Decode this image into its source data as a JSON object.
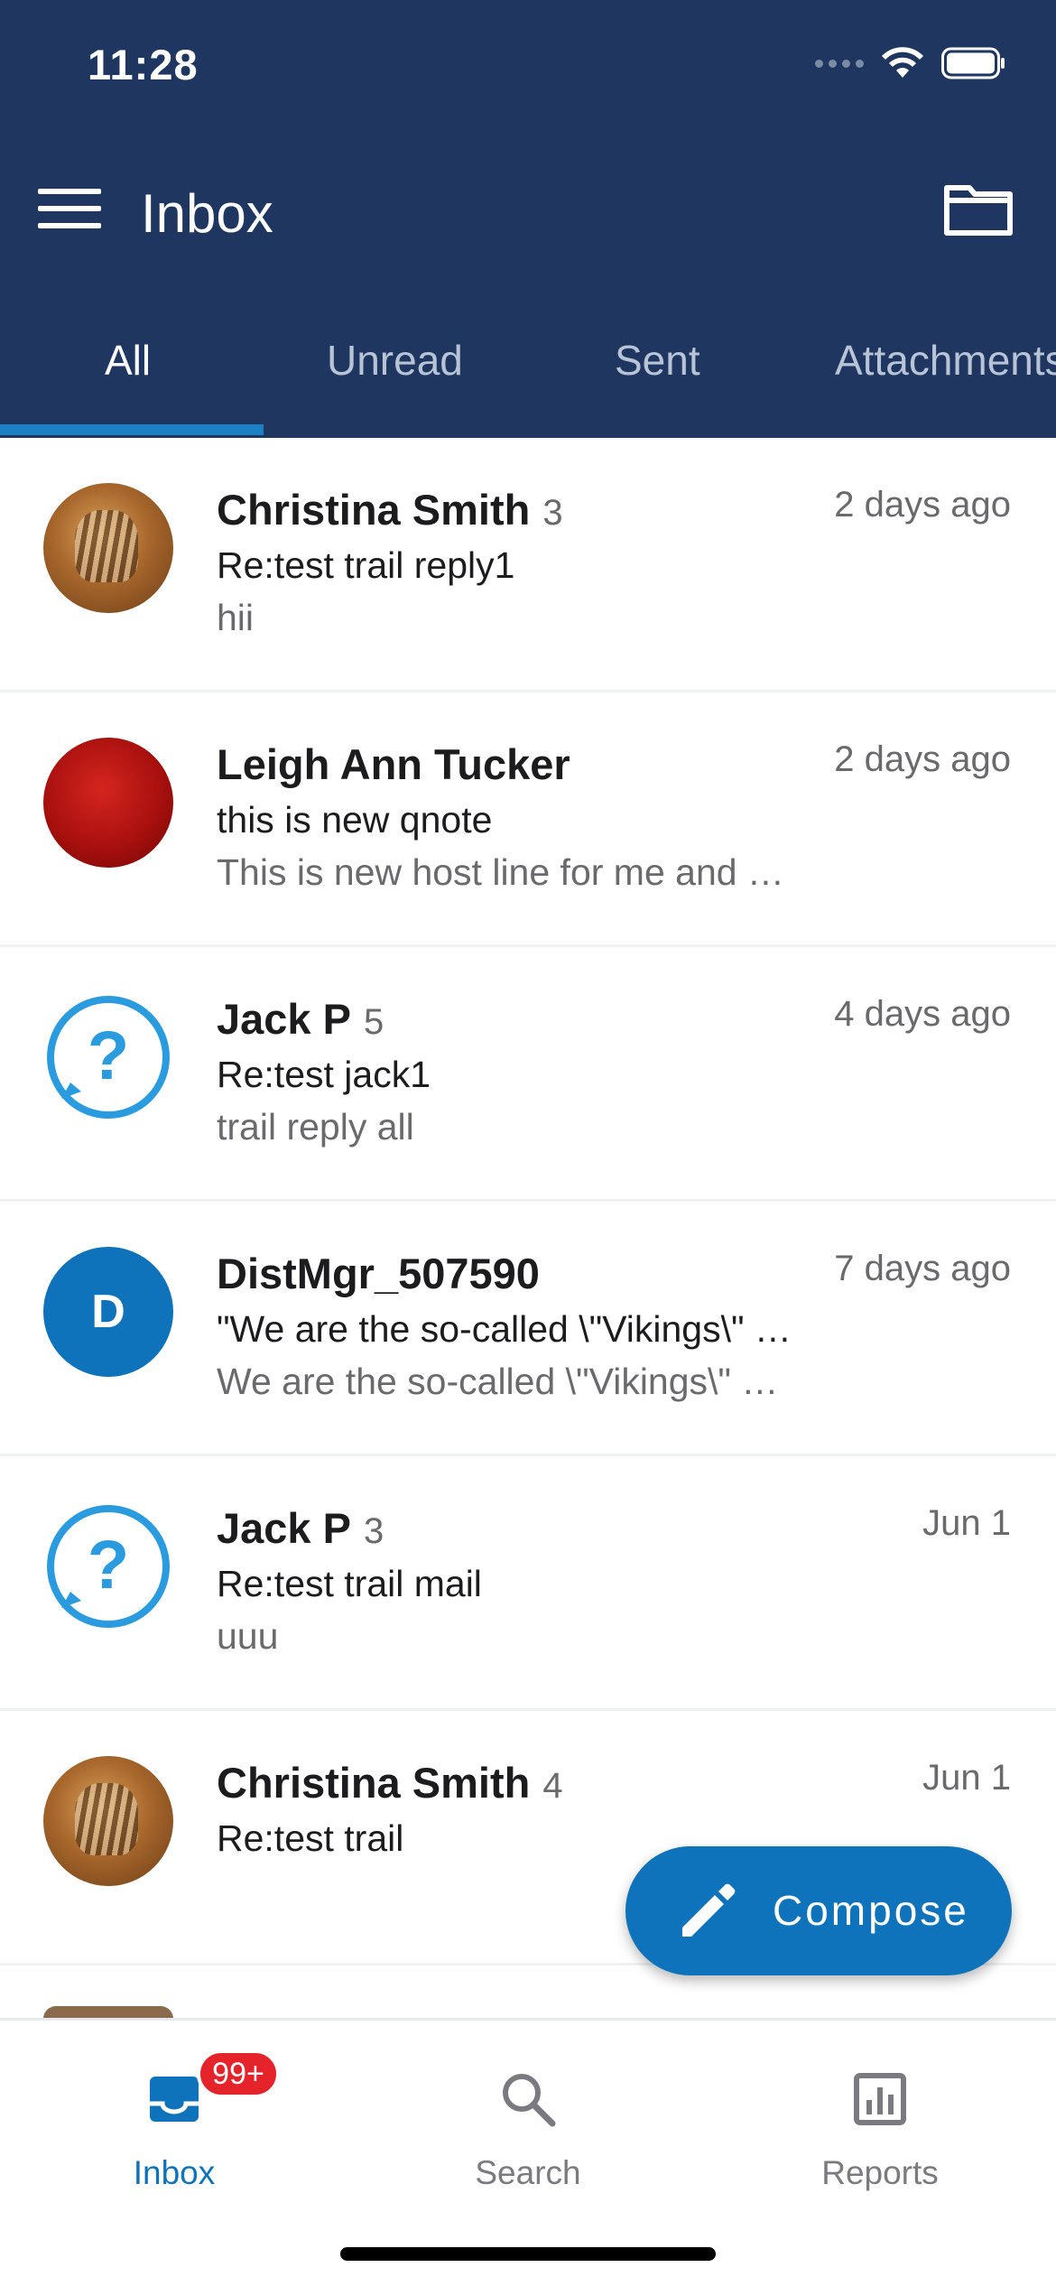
{
  "status_bar": {
    "time": "11:28"
  },
  "header": {
    "title": "Inbox"
  },
  "tabs": [
    {
      "label": "All",
      "active": true
    },
    {
      "label": "Unread",
      "active": false
    },
    {
      "label": "Sent",
      "active": false
    },
    {
      "label": "Attachments",
      "active": false
    }
  ],
  "messages": [
    {
      "sender": "Christina Smith",
      "count": "3",
      "date": "2 days ago",
      "subject": "Re:test trail reply1",
      "preview": "hii",
      "avatar": "photo"
    },
    {
      "sender": "Leigh Ann Tucker",
      "count": "",
      "date": "2 days ago",
      "subject": "this is new qnote",
      "preview": "This is new host line for me and …",
      "avatar": "red"
    },
    {
      "sender": "Jack P",
      "count": "5",
      "date": "4 days ago",
      "subject": "Re:test jack1",
      "preview": "trail reply all",
      "avatar": "unknown"
    },
    {
      "sender": "DistMgr_507590",
      "count": "",
      "date": "7 days ago",
      "subject": "\"We are the so-called \\\"Vikings\\\" …",
      "preview": "We are the so-called \\\"Vikings\\\" …",
      "avatar": "letter",
      "avatar_letter": "D"
    },
    {
      "sender": "Jack P",
      "count": "3",
      "date": "Jun 1",
      "subject": "Re:test trail mail",
      "preview": "uuu",
      "avatar": "unknown"
    },
    {
      "sender": "Christina Smith",
      "count": "4",
      "date": "Jun 1",
      "subject": "Re:test trail",
      "preview": "",
      "avatar": "photo"
    }
  ],
  "fab": {
    "label": "Compose",
    "icon": "pencil-icon"
  },
  "bottom_nav": {
    "items": [
      {
        "label": "Inbox",
        "icon": "inbox-icon",
        "active": true,
        "badge": "99+"
      },
      {
        "label": "Search",
        "icon": "search-icon",
        "active": false
      },
      {
        "label": "Reports",
        "icon": "reports-icon",
        "active": false
      }
    ]
  },
  "colors": {
    "header": "#1e3660",
    "accent": "#0e73bb",
    "tab_indicator": "#1d7fc4",
    "badge": "#e5232b"
  }
}
